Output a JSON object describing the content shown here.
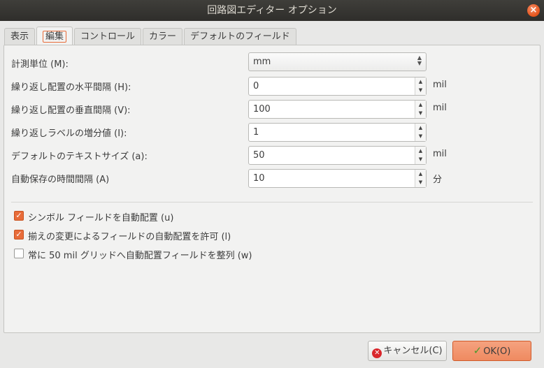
{
  "window": {
    "title": "回路図エディター オプション",
    "close_glyph": "×"
  },
  "tabs": [
    {
      "label": "表示"
    },
    {
      "label": "編集"
    },
    {
      "label": "コントロール"
    },
    {
      "label": "カラー"
    },
    {
      "label": "デフォルトのフィールド"
    }
  ],
  "fields": {
    "units": {
      "label": "計測単位 (M):",
      "value": "mm"
    },
    "repeat_h": {
      "label": "繰り返し配置の水平間隔 (H):",
      "value": "0",
      "unit": "mil"
    },
    "repeat_v": {
      "label": "繰り返し配置の垂直間隔 (V):",
      "value": "100",
      "unit": "mil"
    },
    "repeat_label": {
      "label": "繰り返しラベルの増分値 (I):",
      "value": "1",
      "unit": ""
    },
    "text_size": {
      "label": "デフォルトのテキストサイズ (a):",
      "value": "50",
      "unit": "mil"
    },
    "autosave": {
      "label": "自動保存の時間間隔 (A)",
      "value": "10",
      "unit": "分"
    }
  },
  "checkboxes": [
    {
      "label": "シンボル フィールドを自動配置 (u)",
      "checked": true
    },
    {
      "label": "揃えの変更によるフィールドの自動配置を許可 (l)",
      "checked": true
    },
    {
      "label": "常に 50 mil グリッドへ自動配置フィールドを整列 (w)",
      "checked": false
    }
  ],
  "buttons": {
    "cancel": "キャンセル(C)",
    "ok": "OK(O)"
  },
  "colors": {
    "accent": "#e86c3a",
    "titlebar": "#3c3b37"
  }
}
